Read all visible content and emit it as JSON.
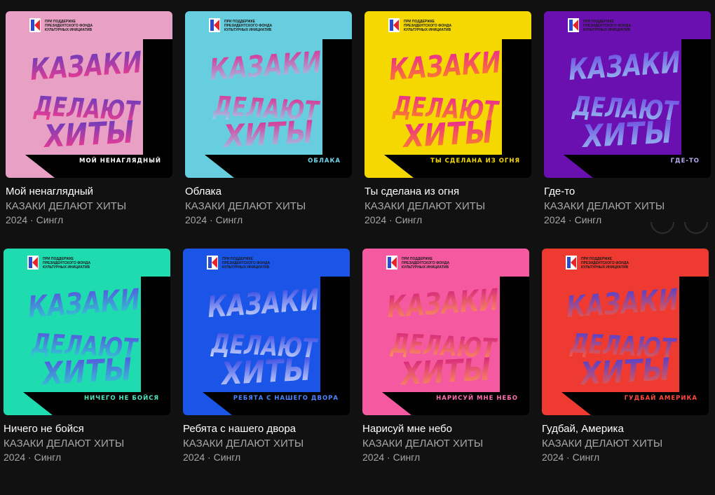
{
  "release_text": {
    "fund_line1": "ПРИ ПОДДЕРЖКЕ",
    "fund_line2": "ПРЕЗИДЕНТСКОГО ФОНДА",
    "fund_line3": "КУЛЬТУРНЫХ ИНИЦИАТИВ",
    "word1": "КАЗАКИ",
    "word2": "ДЕЛАЮТ",
    "word3": "ХИТЫ"
  },
  "releases": [
    {
      "title": "Мой ненаглядный",
      "artist": "КАЗАКИ ДЕЛАЮТ ХИТЫ",
      "meta": "2024 · Сингл",
      "cover_label": "МОЙ НЕНАГЛЯДНЫЙ",
      "bg": "#e8a0c4",
      "grad_top": "#5b3cc4",
      "grad_bottom": "#ff3c8a",
      "label_color": "#ffffff"
    },
    {
      "title": "Облака",
      "artist": "КАЗАКИ ДЕЛАЮТ ХИТЫ",
      "meta": "2024 · Сингл",
      "cover_label": "ОБЛАКА",
      "bg": "#66cedf",
      "grad_top": "#e0208a",
      "grad_bottom": "#9ad8f0",
      "label_color": "#6fd6ea"
    },
    {
      "title": "Ты сделана из огня",
      "artist": "КАЗАКИ ДЕЛАЮТ ХИТЫ",
      "meta": "2024 · Сингл",
      "cover_label": "ТЫ СДЕЛАНА ИЗ ОГНЯ",
      "bg": "#f5d800",
      "grad_top": "#e81ea0",
      "grad_bottom": "#ff8c1a",
      "label_color": "#f5d800"
    },
    {
      "title": "Где-то",
      "artist": "КАЗАКИ ДЕЛАЮТ ХИТЫ",
      "meta": "2024 · Сингл",
      "cover_label": "ГДЕ-ТО",
      "bg": "#6a0fb0",
      "grad_top": "#6a44e0",
      "grad_bottom": "#9bc8f0",
      "label_color": "#b8a8f0"
    },
    {
      "title": "Ничего не бойся",
      "artist": "КАЗАКИ ДЕЛАЮТ ХИТЫ",
      "meta": "2024 · Сингл",
      "cover_label": "НИЧЕГО НЕ БОЙСЯ",
      "bg": "#1fdbb0",
      "grad_top": "#5a48e0",
      "grad_bottom": "#2ed6d0",
      "label_color": "#4de8c0"
    },
    {
      "title": "Ребята с нашего двора",
      "artist": "КАЗАКИ ДЕЛАЮТ ХИТЫ",
      "meta": "2024 · Сингл",
      "cover_label": "РЕБЯТА С НАШЕГО ДВОРА",
      "bg": "#1b55e8",
      "grad_top": "#2a3ce0",
      "grad_bottom": "#d8e4ff",
      "label_color": "#4a86ff"
    },
    {
      "title": "Нарисуй мне небо",
      "artist": "КАЗАКИ ДЕЛАЮТ ХИТЫ",
      "meta": "2024 · Сингл",
      "cover_label": "НАРИСУЙ МНЕ НЕБО",
      "bg": "#f55aa0",
      "grad_top": "#d11a80",
      "grad_bottom": "#ff9a5a",
      "label_color": "#ff6eb0"
    },
    {
      "title": "Гудбай, Америка",
      "artist": "КАЗАКИ ДЕЛАЮТ ХИТЫ",
      "meta": "2024 · Сингл",
      "cover_label": "ГУДБАЙ АМЕРИКА",
      "bg": "#ee3a30",
      "grad_top": "#3e3ee0",
      "grad_bottom": "#ff5a3c",
      "label_color": "#ff4a3c"
    }
  ],
  "icons": {
    "fund_logo": "presidential-fund-logo-icon",
    "nav_prev": "carousel-prev-button",
    "nav_next": "carousel-next-button"
  }
}
